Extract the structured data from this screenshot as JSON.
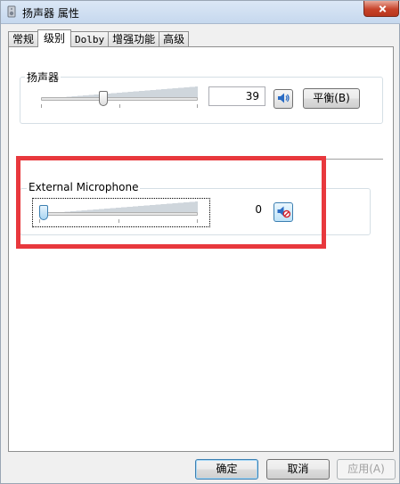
{
  "window": {
    "title": "扬声器 属性"
  },
  "tabs": [
    {
      "label": "常规",
      "active": false
    },
    {
      "label": "级别",
      "active": true
    },
    {
      "label": "Dolby",
      "active": false
    },
    {
      "label": "增强功能",
      "active": false
    },
    {
      "label": "高级",
      "active": false
    }
  ],
  "speaker": {
    "label": "扬声器",
    "value": "39",
    "level_percent": 39,
    "balance_label": "平衡(B)",
    "mute_icon": "speaker-icon"
  },
  "microphone": {
    "label": "External Microphone",
    "value": "0",
    "level_percent": 0,
    "mute_icon": "speaker-muted-icon"
  },
  "footer": {
    "ok_label": "确定",
    "cancel_label": "取消",
    "apply_label": "应用(A)"
  },
  "colors": {
    "highlight": "#e8383d",
    "mute_icon_blue": "#2b6cc4"
  }
}
